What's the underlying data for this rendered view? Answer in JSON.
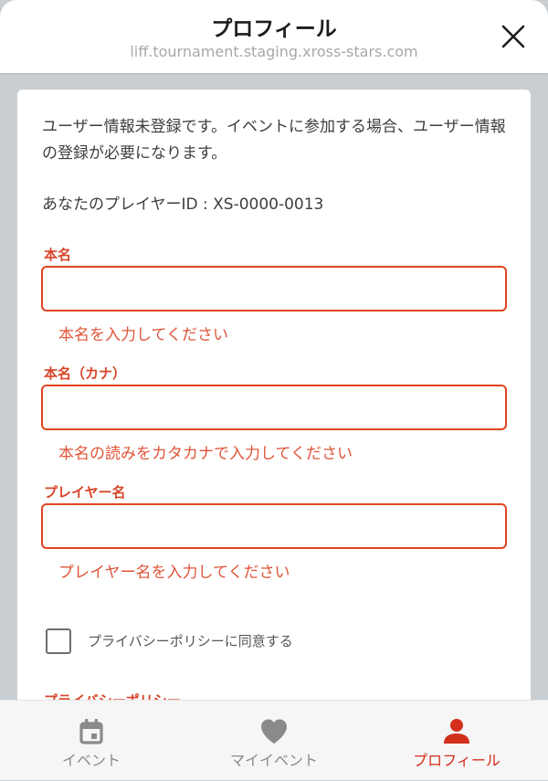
{
  "header": {
    "title": "プロフィール",
    "url": "liff.tournament.staging.xross-stars.com",
    "close_icon": "close-icon"
  },
  "form": {
    "notice": "ユーザー情報未登録です。イベントに参加する場合、ユーザー情報の登録が必要になります。",
    "player_id": "あなたのプレイヤーID : XS-0000-0013",
    "fields": [
      {
        "label": "本名",
        "value": "",
        "error": "本名を入力してください"
      },
      {
        "label": "本名（カナ）",
        "value": "",
        "error": "本名の読みをカタカナで入力してください"
      },
      {
        "label": "プレイヤー名",
        "value": "",
        "error": "プレイヤー名を入力してください"
      }
    ],
    "privacy_checkbox": {
      "label": "プライバシーポリシーに同意する",
      "checked": false
    },
    "privacy_link": "プライバシーポリシー"
  },
  "tabbar": {
    "tabs": [
      {
        "label": "イベント",
        "icon": "calendar-icon",
        "active": false
      },
      {
        "label": "マイイベント",
        "icon": "heart-icon",
        "active": false
      },
      {
        "label": "プロフィール",
        "icon": "person-icon",
        "active": true
      }
    ]
  },
  "colors": {
    "accent": "#d22f1d",
    "error_border": "#e0441f",
    "inactive_tab": "#8a8a8a",
    "backdrop": "#c9ced3"
  }
}
